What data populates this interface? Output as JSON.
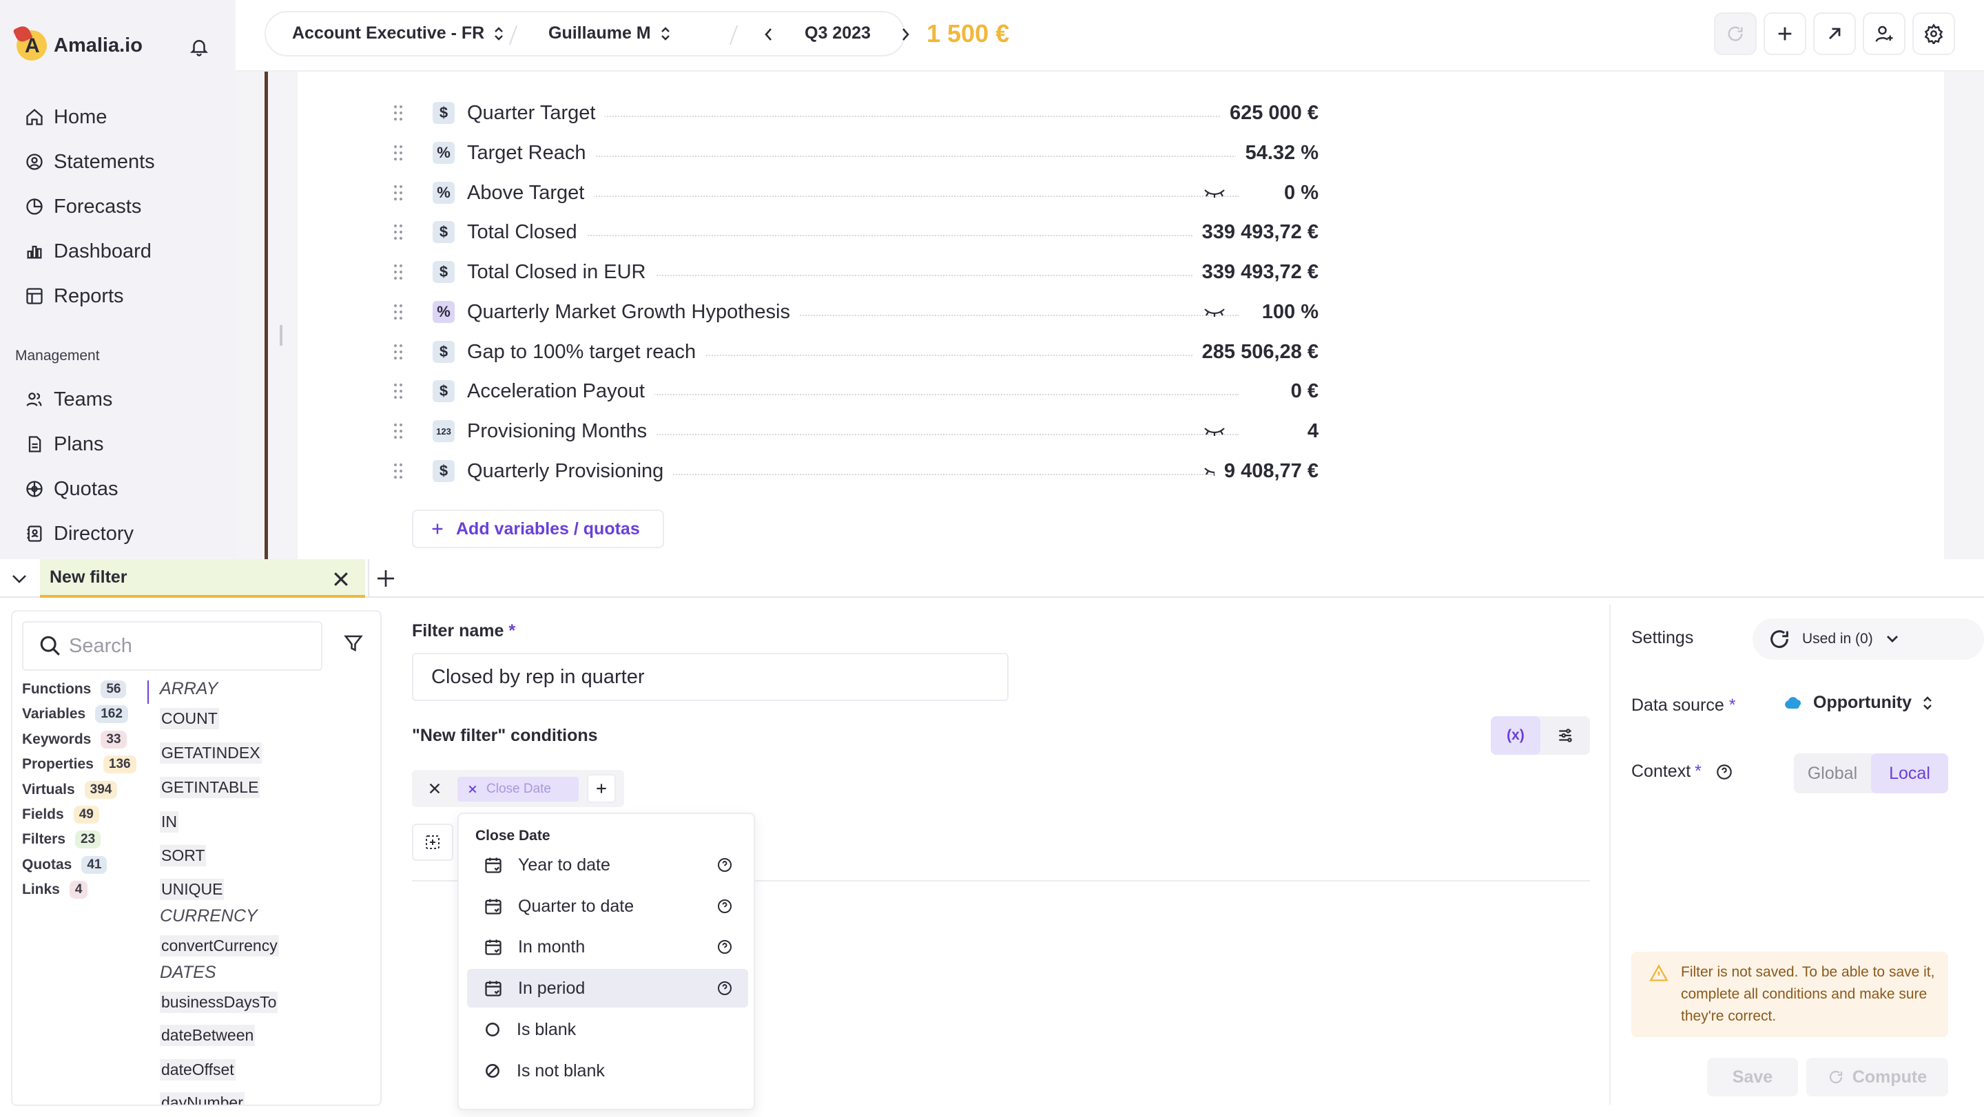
{
  "sidebar": {
    "brand": "Amalia.io",
    "nav": [
      {
        "label": "Home",
        "icon": "home-icon"
      },
      {
        "label": "Statements",
        "icon": "statements-icon"
      },
      {
        "label": "Forecasts",
        "icon": "forecasts-icon"
      },
      {
        "label": "Dashboard",
        "icon": "dashboard-icon"
      },
      {
        "label": "Reports",
        "icon": "reports-icon"
      }
    ],
    "section_label": "Management",
    "management": [
      {
        "label": "Teams",
        "icon": "teams-icon"
      },
      {
        "label": "Plans",
        "icon": "plans-icon"
      },
      {
        "label": "Quotas",
        "icon": "quotas-icon"
      },
      {
        "label": "Directory",
        "icon": "directory-icon"
      }
    ]
  },
  "topbar": {
    "plan": "Account Executive - FR",
    "user": "Guillaume M",
    "period": "Q3 2023",
    "payout": "1 500 €",
    "accent": "#f0b73a"
  },
  "statement": {
    "rows": [
      {
        "type": "$",
        "label": "Quarter Target",
        "value": "625 000 €",
        "hidden": false
      },
      {
        "type": "%",
        "label": "Target Reach",
        "value": "54.32 %",
        "hidden": false
      },
      {
        "type": "%",
        "label": "Above Target",
        "value": "0 %",
        "hidden": true
      },
      {
        "type": "$",
        "label": "Total Closed",
        "value": "339 493,72 €",
        "hidden": false
      },
      {
        "type": "$",
        "label": "Total Closed in EUR",
        "value": "339 493,72 €",
        "hidden": true
      },
      {
        "type": "%",
        "label": "Quarterly Market Growth Hypothesis",
        "value": "100 %",
        "hidden": true
      },
      {
        "type": "$",
        "label": "Gap to 100% target reach",
        "value": "285 506,28 €",
        "hidden": false
      },
      {
        "type": "$",
        "label": "Acceleration Payout",
        "value": "0 €",
        "hidden": false
      },
      {
        "type": "123",
        "label": "Provisioning Months",
        "value": "4",
        "hidden": true
      },
      {
        "type": "$",
        "label": "Quarterly Provisioning",
        "value": "9 408,77 €",
        "hidden": true
      }
    ],
    "add_button": "Add variables / quotas"
  },
  "editor": {
    "tab_label": "New filter",
    "search_placeholder": "Search",
    "categories": [
      {
        "label": "Functions",
        "count": "56",
        "color": "#e2e6ee"
      },
      {
        "label": "Variables",
        "count": "162",
        "color": "#dfe8f1"
      },
      {
        "label": "Keywords",
        "count": "33",
        "color": "#f4e1e6"
      },
      {
        "label": "Properties",
        "count": "136",
        "color": "#fbeed0"
      },
      {
        "label": "Virtuals",
        "count": "394",
        "color": "#fbeed0"
      },
      {
        "label": "Fields",
        "count": "49",
        "color": "#fbeed0"
      },
      {
        "label": "Filters",
        "count": "23",
        "color": "#e6f3dd"
      },
      {
        "label": "Quotas",
        "count": "41",
        "color": "#dfe8f1"
      },
      {
        "label": "Links",
        "count": "4",
        "color": "#f4e1e6"
      }
    ],
    "groups": {
      "array": "ARRAY",
      "array_fns": [
        "COUNT",
        "GETATINDEX",
        "GETINTABLE",
        "IN",
        "SORT",
        "UNIQUE"
      ],
      "currency": "CURRENCY",
      "currency_fns": [
        "convertCurrency"
      ],
      "dates": "DATES",
      "dates_fns": [
        "businessDaysTo",
        "dateBetween",
        "dateOffset",
        "dayNumber"
      ]
    },
    "filter_name_label": "Filter name",
    "filter_name_value": "Closed by rep in quarter",
    "conditions_label": "\"New filter\" conditions",
    "toggle_formula": "(x)",
    "chip_label": "Close Date",
    "menu": {
      "header": "Close Date",
      "items": [
        "Year to date",
        "Quarter to date",
        "In month",
        "In period",
        "Is blank",
        "Is not blank"
      ]
    },
    "settings_label": "Settings",
    "used_in": "Used in (0)",
    "data_source_label": "Data source",
    "data_source_value": "Opportunity",
    "context_label": "Context",
    "context_options": [
      "Global",
      "Local"
    ],
    "warning": "Filter is not saved. To be able to save it, complete all conditions and make sure they're correct.",
    "save_button": "Save",
    "compute_button": "Compute",
    "required_mark": "*"
  }
}
